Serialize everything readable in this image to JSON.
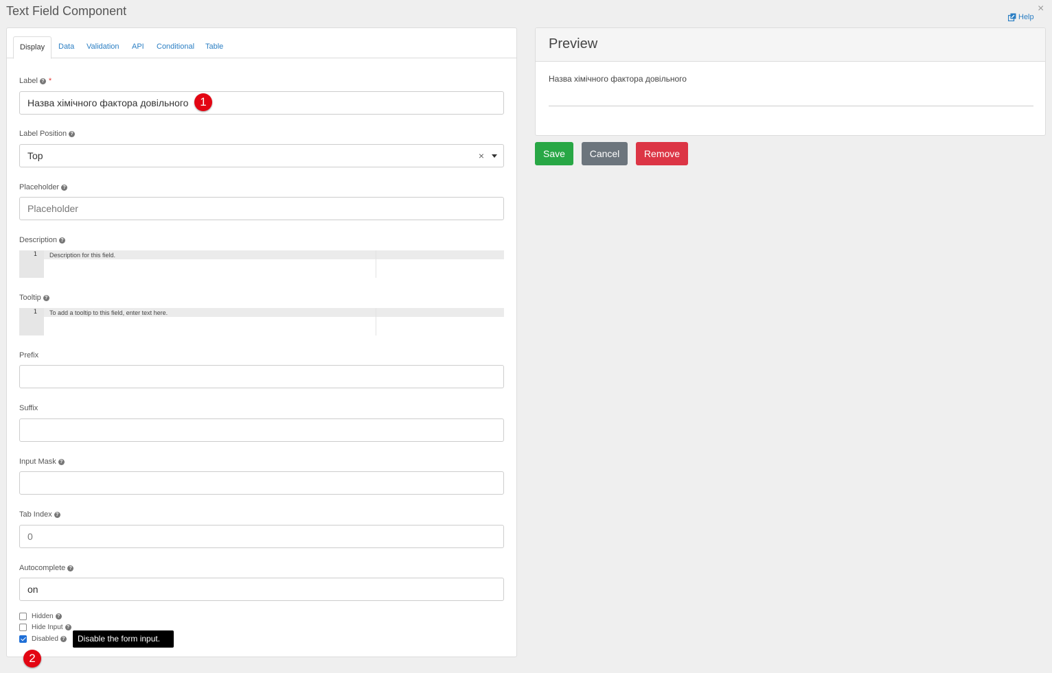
{
  "window": {
    "title": "Text Field Component",
    "help_label": "Help",
    "close_glyph": "×"
  },
  "tabs": [
    {
      "label": "Display",
      "active": true
    },
    {
      "label": "Data"
    },
    {
      "label": "Validation"
    },
    {
      "label": "API"
    },
    {
      "label": "Conditional"
    },
    {
      "label": "Table"
    }
  ],
  "form": {
    "label": {
      "label": "Label",
      "required": "*",
      "value": "Назва хімічного фактора довільного"
    },
    "label_position": {
      "label": "Label Position",
      "value": "Top",
      "clear": "×"
    },
    "placeholder": {
      "label": "Placeholder",
      "placeholder": "Placeholder"
    },
    "description": {
      "label": "Description",
      "line_number": "1",
      "text": "Description for this field."
    },
    "tooltip": {
      "label": "Tooltip",
      "line_number": "1",
      "text": "To add a tooltip to this field, enter text here."
    },
    "prefix": {
      "label": "Prefix",
      "value": ""
    },
    "suffix": {
      "label": "Suffix",
      "value": ""
    },
    "input_mask": {
      "label": "Input Mask",
      "value": ""
    },
    "tab_index": {
      "label": "Tab Index",
      "placeholder": "0"
    },
    "autocomplete": {
      "label": "Autocomplete",
      "value": "on"
    },
    "checkboxes": {
      "hidden": {
        "label": "Hidden",
        "checked": false
      },
      "hide_input": {
        "label": "Hide Input",
        "checked": false
      },
      "disabled": {
        "label": "Disabled",
        "checked": true
      }
    },
    "tooltip_popup": "Disable the form input.",
    "help_glyph": "?"
  },
  "annotations": {
    "badge1": "1",
    "badge2": "2",
    "badge_color": "#e30613"
  },
  "preview": {
    "title": "Preview",
    "field_label": "Назва хімічного фактора довільного"
  },
  "actions": {
    "save": "Save",
    "cancel": "Cancel",
    "remove": "Remove",
    "colors": {
      "save": "#28a745",
      "cancel": "#6c757d",
      "remove": "#dc3545"
    }
  }
}
